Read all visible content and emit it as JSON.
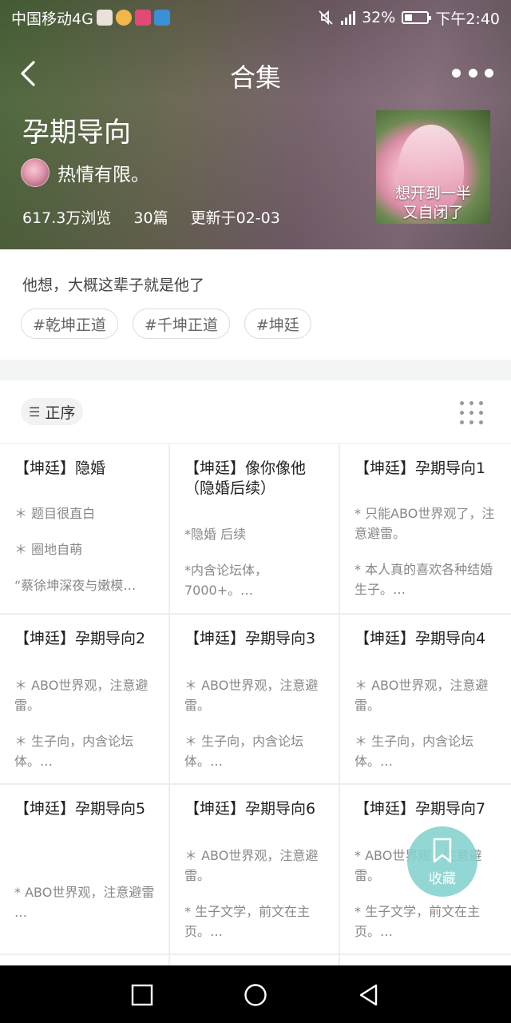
{
  "status_bar": {
    "carrier": "中国移动4G",
    "battery_pct": "32%",
    "time": "下午2:40"
  },
  "nav": {
    "title": "合集"
  },
  "collection": {
    "title": "孕期导向",
    "author": "热情有限。",
    "views": "617.3万浏览",
    "count": "30篇",
    "updated": "更新于02-03",
    "cover_caption_line1": "想开到一半",
    "cover_caption_line2": "又自闭了"
  },
  "description": {
    "text": "他想，大概这辈子就是他了",
    "tags": [
      "#乾坤正道",
      "#千坤正道",
      "#坤廷"
    ]
  },
  "sort": {
    "label": "正序"
  },
  "cards": [
    {
      "title": "【坤廷】隐婚",
      "lines": [
        "＊ 题目很直白",
        "＊ 圈地自萌",
        "“蔡徐坤深夜与嫩模…"
      ]
    },
    {
      "title": "【坤廷】像你像他（隐婚后续）",
      "lines": [
        "*隐婚 后续",
        "*内含论坛体，7000+。…"
      ]
    },
    {
      "title": "【坤廷】孕期导向1",
      "lines": [
        "* 只能ABO世界观了，注意避雷。",
        "* 本人真的喜欢各种结婚生子。…"
      ]
    },
    {
      "title": "【坤廷】孕期导向2",
      "lines": [
        "＊ ABO世界观，注意避雷。",
        "＊ 生子向，内含论坛体。…"
      ]
    },
    {
      "title": "【坤廷】孕期导向3",
      "lines": [
        "＊ ABO世界观，注意避雷。",
        "＊ 生子向，内含论坛体。…"
      ]
    },
    {
      "title": "【坤廷】孕期导向4",
      "lines": [
        "＊ ABO世界观，注意避雷。",
        "＊ 生子向，内含论坛体。…"
      ]
    },
    {
      "title": "【坤廷】孕期导向5",
      "lines": [
        "* ABO世界观，注意避雷",
        "…"
      ]
    },
    {
      "title": "【坤廷】孕期导向6",
      "lines": [
        "＊ ABO世界观，注意避雷。",
        "* 生子文学，前文在主页。…"
      ]
    },
    {
      "title": "【坤廷】孕期导向7",
      "lines": [
        "* ABO世界观，注意避雷。",
        "* 生子文学，前文在主页。…"
      ]
    }
  ],
  "fab": {
    "label": "收藏"
  }
}
